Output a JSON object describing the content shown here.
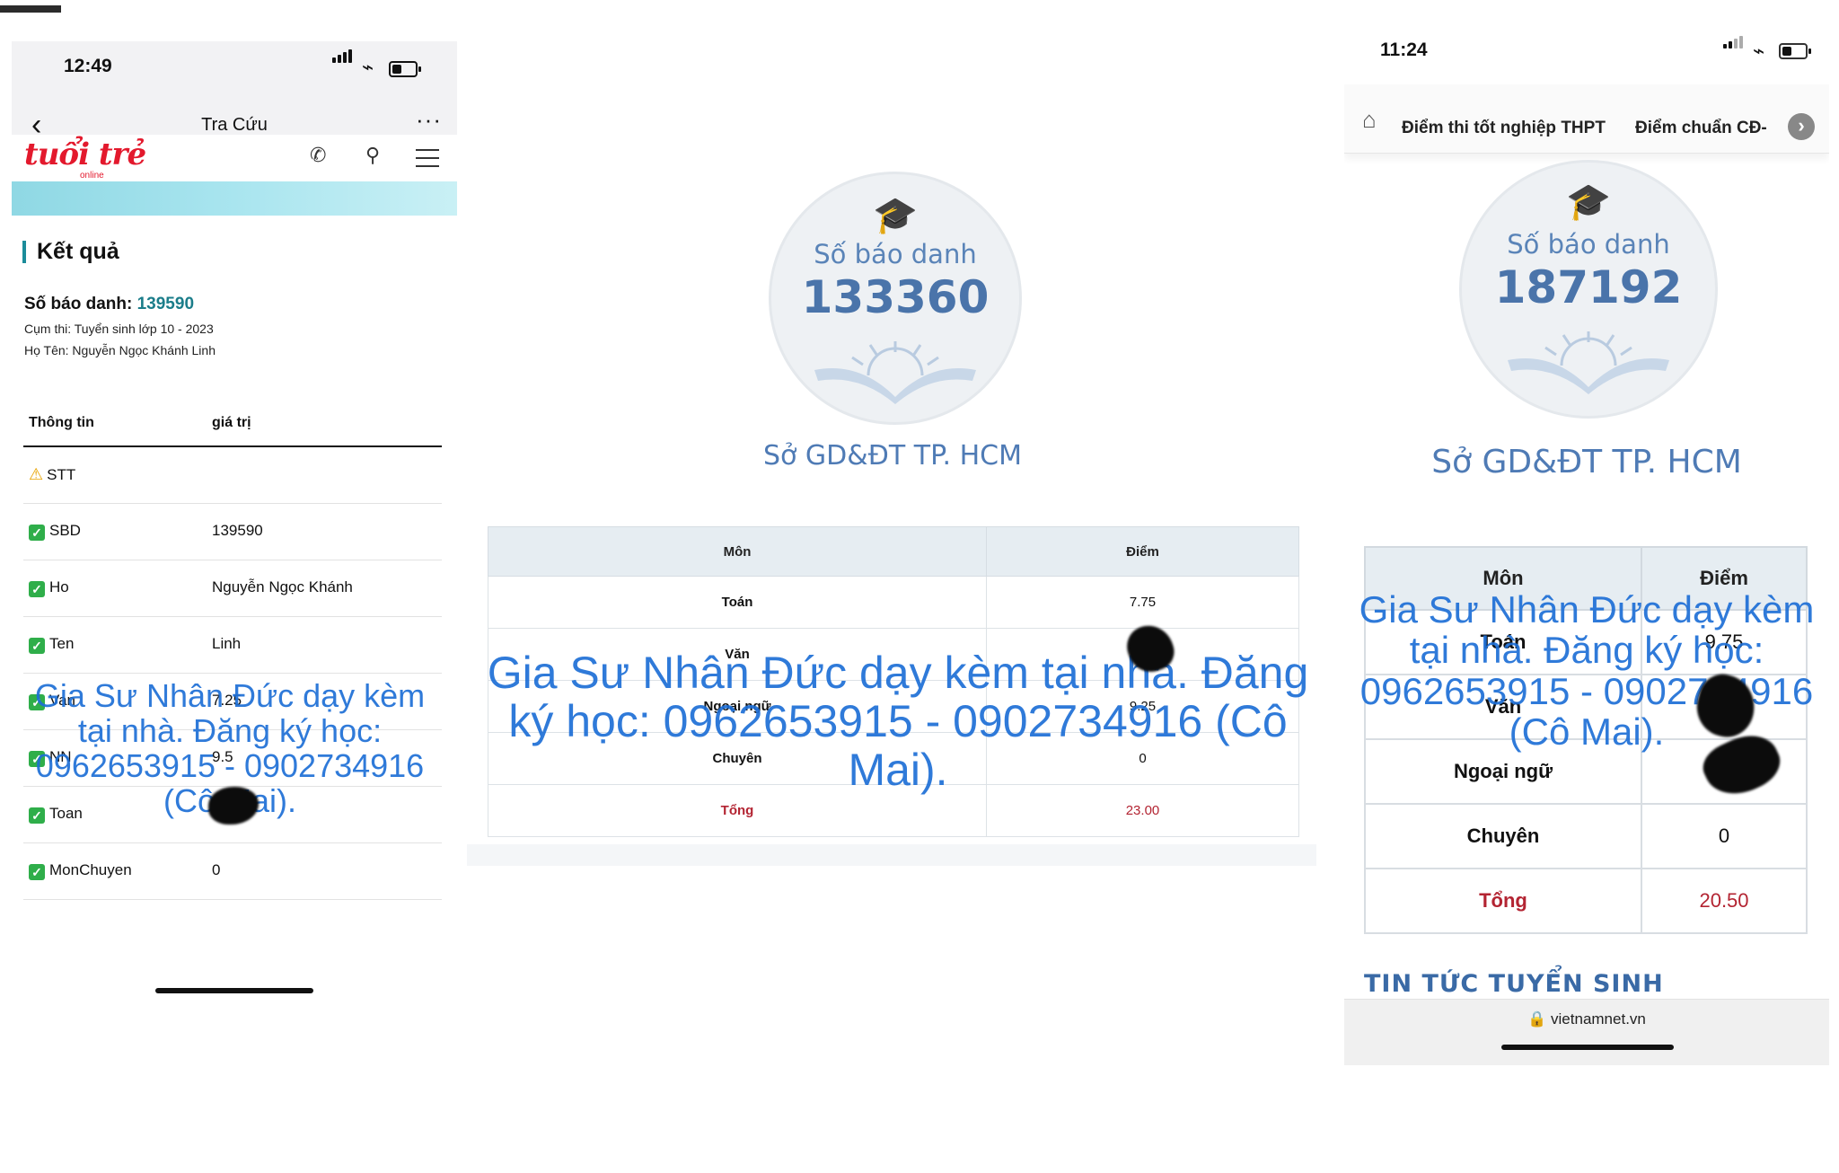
{
  "panel1": {
    "time": "12:49",
    "nav_title": "Tra Cứu",
    "more": "···",
    "back": "‹",
    "logo": "tuổi trẻ",
    "logo_sub": "online",
    "section_title": "Kết quả",
    "sbd_label": "Số báo danh:",
    "sbd_value": "139590",
    "cluster": "Cụm thi: Tuyển sinh lớp 10 - 2023",
    "fullname": "Họ Tên: Nguyễn Ngọc Khánh Linh",
    "col_info": "Thông tin",
    "col_value": "giá trị",
    "rows": [
      {
        "key": "STT",
        "value": "",
        "icon": "warning"
      },
      {
        "key": "SBD",
        "value": "139590",
        "icon": "check"
      },
      {
        "key": "Ho",
        "value": "Nguyễn Ngọc Khánh",
        "icon": "check"
      },
      {
        "key": "Ten",
        "value": "Linh",
        "icon": "check"
      },
      {
        "key": "Van",
        "value": "7.25",
        "icon": "check"
      },
      {
        "key": "NN",
        "value": "9.5",
        "icon": "check"
      },
      {
        "key": "Toan",
        "value": "",
        "icon": "check"
      },
      {
        "key": "MonChuyen",
        "value": "0",
        "icon": "check"
      }
    ],
    "watermark": "Gia Sư Nhân Đức dạy kèm tại nhà. Đăng ký học: 0962653915 - 0902734916 (Cô Mai)."
  },
  "panel2": {
    "badge_label": "Số báo danh",
    "badge_number": "133360",
    "department": "Sở GD&ĐT TP. HCM",
    "col_subject": "Môn",
    "col_score": "Điểm",
    "rows": [
      {
        "subject": "Toán",
        "score": "7.75"
      },
      {
        "subject": "Văn",
        "score": ""
      },
      {
        "subject": "Ngoại ngữ",
        "score": "9.25"
      },
      {
        "subject": "Chuyên",
        "score": "0"
      }
    ],
    "total_label": "Tổng",
    "total_value": "23.00",
    "watermark": "Gia Sư Nhân Đức dạy kèm tại nhà. Đăng ký học: 0962653915 - 0902734916 (Cô Mai)."
  },
  "panel3": {
    "time": "11:24",
    "tab1": "Điểm thi tốt nghiệp THPT",
    "tab2": "Điểm chuẩn CĐ-",
    "badge_label": "Số báo danh",
    "badge_number": "187192",
    "department": "Sở GD&ĐT TP. HCM",
    "col_subject": "Môn",
    "col_score": "Điểm",
    "rows": [
      {
        "subject": "Toán",
        "score": "9.75"
      },
      {
        "subject": "Văn",
        "score": ""
      },
      {
        "subject": "Ngoại ngữ",
        "score": ""
      },
      {
        "subject": "Chuyên",
        "score": "0"
      }
    ],
    "total_label": "Tổng",
    "total_value": "20.50",
    "news_heading": "TIN TỨC TUYỂN SINH",
    "url": "vietnamnet.vn",
    "watermark": "Gia Sư Nhân Đức dạy kèm tại nhà. Đăng ký học: 0962653915 - 0902734916 (Cô Mai)."
  },
  "colors": {
    "accent_teal": "#1b7d8a",
    "logo_red": "#e3192d",
    "badge_blue": "#4a74aa",
    "total_red": "#b32432",
    "watermark_blue": "#1e6fd6",
    "check_green": "#2fae4a"
  }
}
